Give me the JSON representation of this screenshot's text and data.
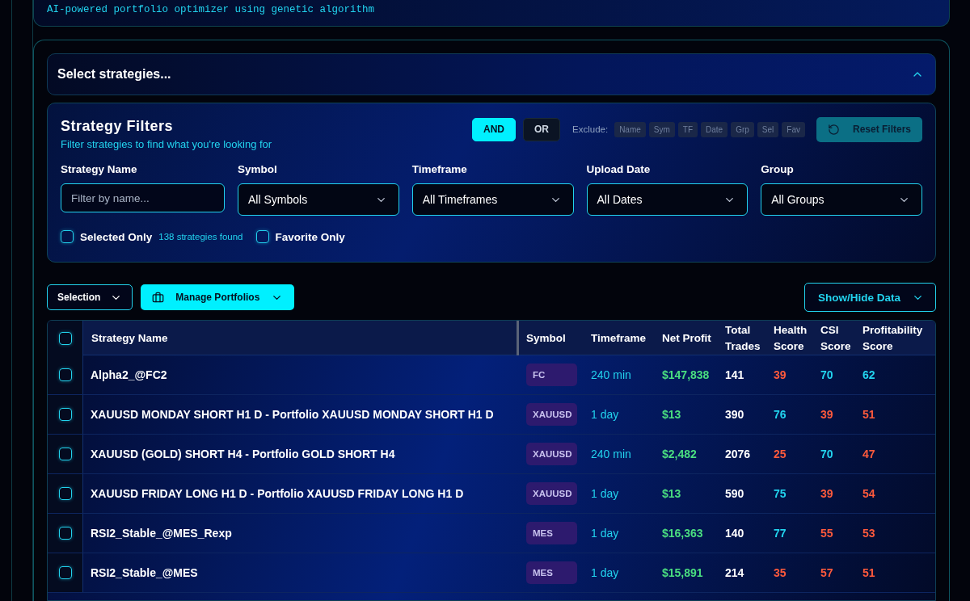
{
  "optimizer_card": {
    "subtitle": "AI-powered portfolio optimizer using genetic algorithm"
  },
  "strategy_picker": {
    "title": "Select strategies...",
    "expanded": true
  },
  "filters": {
    "title": "Strategy Filters",
    "subtitle": "Filter strategies to find what you're looking for",
    "logic": [
      {
        "label": "AND",
        "selected": true
      },
      {
        "label": "OR",
        "selected": false
      }
    ],
    "exclude_label": "Exclude:",
    "exclude": [
      {
        "label": "Name",
        "on": false
      },
      {
        "label": "Sym",
        "on": false
      },
      {
        "label": "TF",
        "on": false
      },
      {
        "label": "Date",
        "on": false
      },
      {
        "label": "Grp",
        "on": false
      },
      {
        "label": "Sel",
        "on": false
      },
      {
        "label": "Fav",
        "on": false
      }
    ],
    "reset_button": "Reset Filters",
    "fields": [
      {
        "kind": "text",
        "label": "Strategy Name",
        "placeholder": "Filter by name..."
      },
      {
        "kind": "select",
        "label": "Symbol",
        "value": "All Symbols"
      },
      {
        "kind": "select",
        "label": "Timeframe",
        "value": "All Timeframes"
      },
      {
        "kind": "select",
        "label": "Upload Date",
        "value": "All Dates"
      },
      {
        "kind": "select",
        "label": "Group",
        "value": "All Groups"
      }
    ],
    "selected_only": {
      "label": "Selected Only",
      "checked": false
    },
    "found": "138 strategies found",
    "favorite_only": {
      "label": "Favorite Only",
      "checked": false
    }
  },
  "toolbar": {
    "selection": "Selection",
    "manage": "Manage Portfolios",
    "show_hide": "Show/Hide Data"
  },
  "table": {
    "header_checked": false,
    "columns": [
      "Strategy Name",
      "Symbol",
      "Timeframe",
      "Net Profit",
      "Total Trades",
      "Health Score",
      "CSI Score",
      "Profitability Score"
    ],
    "rows": [
      {
        "checked": false,
        "name": "Alpha2_@FC2",
        "symbol": "FC",
        "timeframe": "240 min",
        "net_profit": "$147,838",
        "trades": "141",
        "scores": [
          {
            "value": "39",
            "color": "#ff5a3c"
          },
          {
            "value": "70",
            "color": "#22d3ee"
          },
          {
            "value": "62",
            "color": "#22d3ee"
          }
        ]
      },
      {
        "checked": false,
        "name": "XAUUSD MONDAY SHORT H1 D - Portfolio XAUUSD MONDAY SHORT H1 D",
        "symbol": "XAUUSD",
        "timeframe": "1 day",
        "net_profit": "$13",
        "trades": "390",
        "scores": [
          {
            "value": "76",
            "color": "#22d3ee"
          },
          {
            "value": "39",
            "color": "#ff5a3c"
          },
          {
            "value": "51",
            "color": "#ff5a3c"
          }
        ]
      },
      {
        "checked": false,
        "name": "XAUUSD (GOLD) SHORT H4 - Portfolio GOLD SHORT H4",
        "symbol": "XAUUSD",
        "timeframe": "240 min",
        "net_profit": "$2,482",
        "trades": "2076",
        "scores": [
          {
            "value": "25",
            "color": "#ff5a3c"
          },
          {
            "value": "70",
            "color": "#22d3ee"
          },
          {
            "value": "47",
            "color": "#ff5a3c"
          }
        ]
      },
      {
        "checked": false,
        "name": "XAUUSD FRIDAY LONG H1 D - Portfolio XAUUSD FRIDAY LONG H1 D",
        "symbol": "XAUUSD",
        "timeframe": "1 day",
        "net_profit": "$13",
        "trades": "590",
        "scores": [
          {
            "value": "75",
            "color": "#22d3ee"
          },
          {
            "value": "39",
            "color": "#ff5a3c"
          },
          {
            "value": "54",
            "color": "#ff5a3c"
          }
        ]
      },
      {
        "checked": false,
        "name": "RSI2_Stable_@MES_Rexp",
        "symbol": "MES",
        "timeframe": "1 day",
        "net_profit": "$16,363",
        "trades": "140",
        "scores": [
          {
            "value": "77",
            "color": "#22d3ee"
          },
          {
            "value": "55",
            "color": "#ff5a3c"
          },
          {
            "value": "53",
            "color": "#ff5a3c"
          }
        ]
      },
      {
        "checked": false,
        "name": "RSI2_Stable_@MES",
        "symbol": "MES",
        "timeframe": "1 day",
        "net_profit": "$15,891",
        "trades": "214",
        "scores": [
          {
            "value": "35",
            "color": "#ff5a3c"
          },
          {
            "value": "57",
            "color": "#ff5a3c"
          },
          {
            "value": "51",
            "color": "#ff5a3c"
          }
        ]
      }
    ]
  }
}
